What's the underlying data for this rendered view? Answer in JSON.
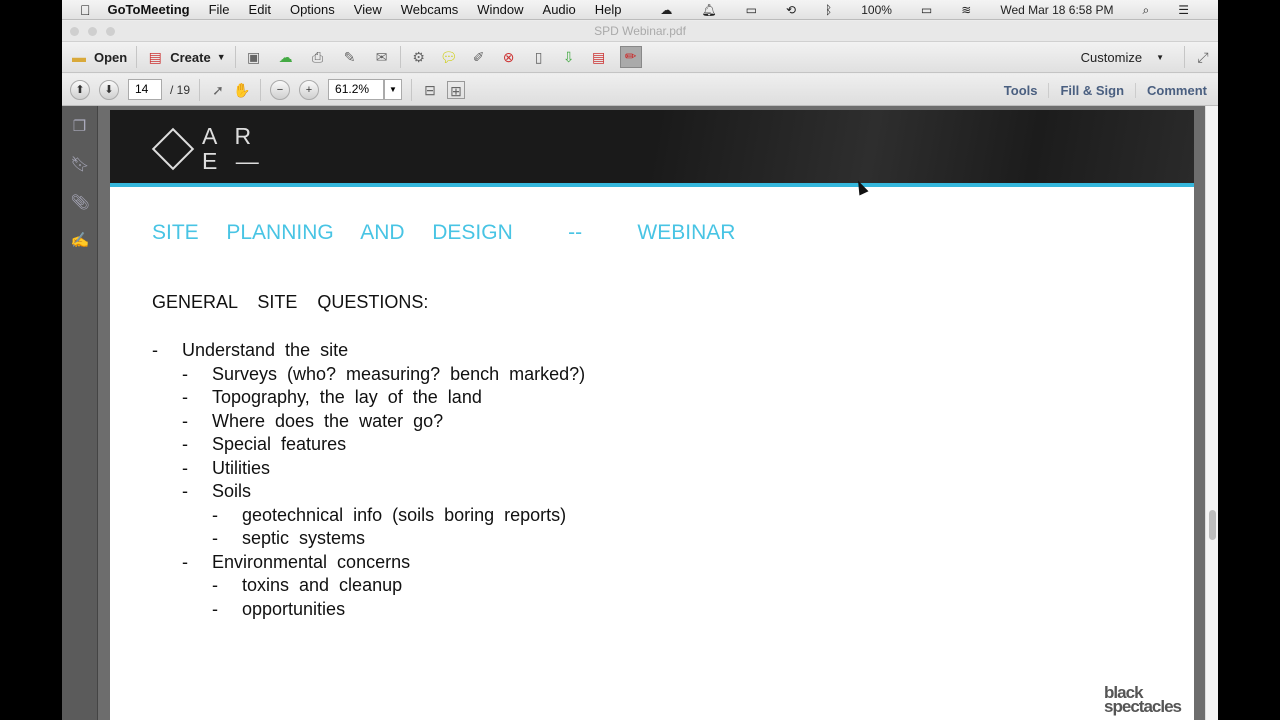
{
  "menubar": {
    "app": "GoToMeeting",
    "items": [
      "File",
      "Edit",
      "Options",
      "View",
      "Webcams",
      "Window",
      "Audio",
      "Help"
    ],
    "battery": "100%",
    "datetime": "Wed Mar 18  6:58 PM"
  },
  "window": {
    "title": "SPD Webinar.pdf"
  },
  "toolbar": {
    "open": "Open",
    "create": "Create",
    "customize": "Customize"
  },
  "nav": {
    "page": "14",
    "total": "/ 19",
    "zoom": "61.2%",
    "tools": "Tools",
    "fill_sign": "Fill & Sign",
    "comment": "Comment"
  },
  "doc": {
    "logo": "AR E—",
    "logo_line1": "A R",
    "logo_line2": "E —",
    "title": "SITE  PLANNING  AND  DESIGN    --    WEBINAR",
    "heading": "GENERAL  SITE  QUESTIONS:",
    "items": [
      {
        "level": 0,
        "text": "Understand the site"
      },
      {
        "level": 1,
        "text": "Surveys (who? measuring? bench marked?)"
      },
      {
        "level": 1,
        "text": "Topography, the lay of the land"
      },
      {
        "level": 1,
        "text": "Where does the water go?"
      },
      {
        "level": 1,
        "text": "Special features"
      },
      {
        "level": 1,
        "text": "Utilities"
      },
      {
        "level": 1,
        "text": "Soils"
      },
      {
        "level": 2,
        "text": "geotechnical info (soils boring reports)"
      },
      {
        "level": 2,
        "text": "septic systems"
      },
      {
        "level": 1,
        "text": "Environmental concerns"
      },
      {
        "level": 2,
        "text": "toxins and cleanup"
      },
      {
        "level": 2,
        "text": "opportunities"
      }
    ],
    "brand": "black spectacles"
  },
  "colors": {
    "accent": "#48c4e4",
    "link": "#4a5f80"
  }
}
